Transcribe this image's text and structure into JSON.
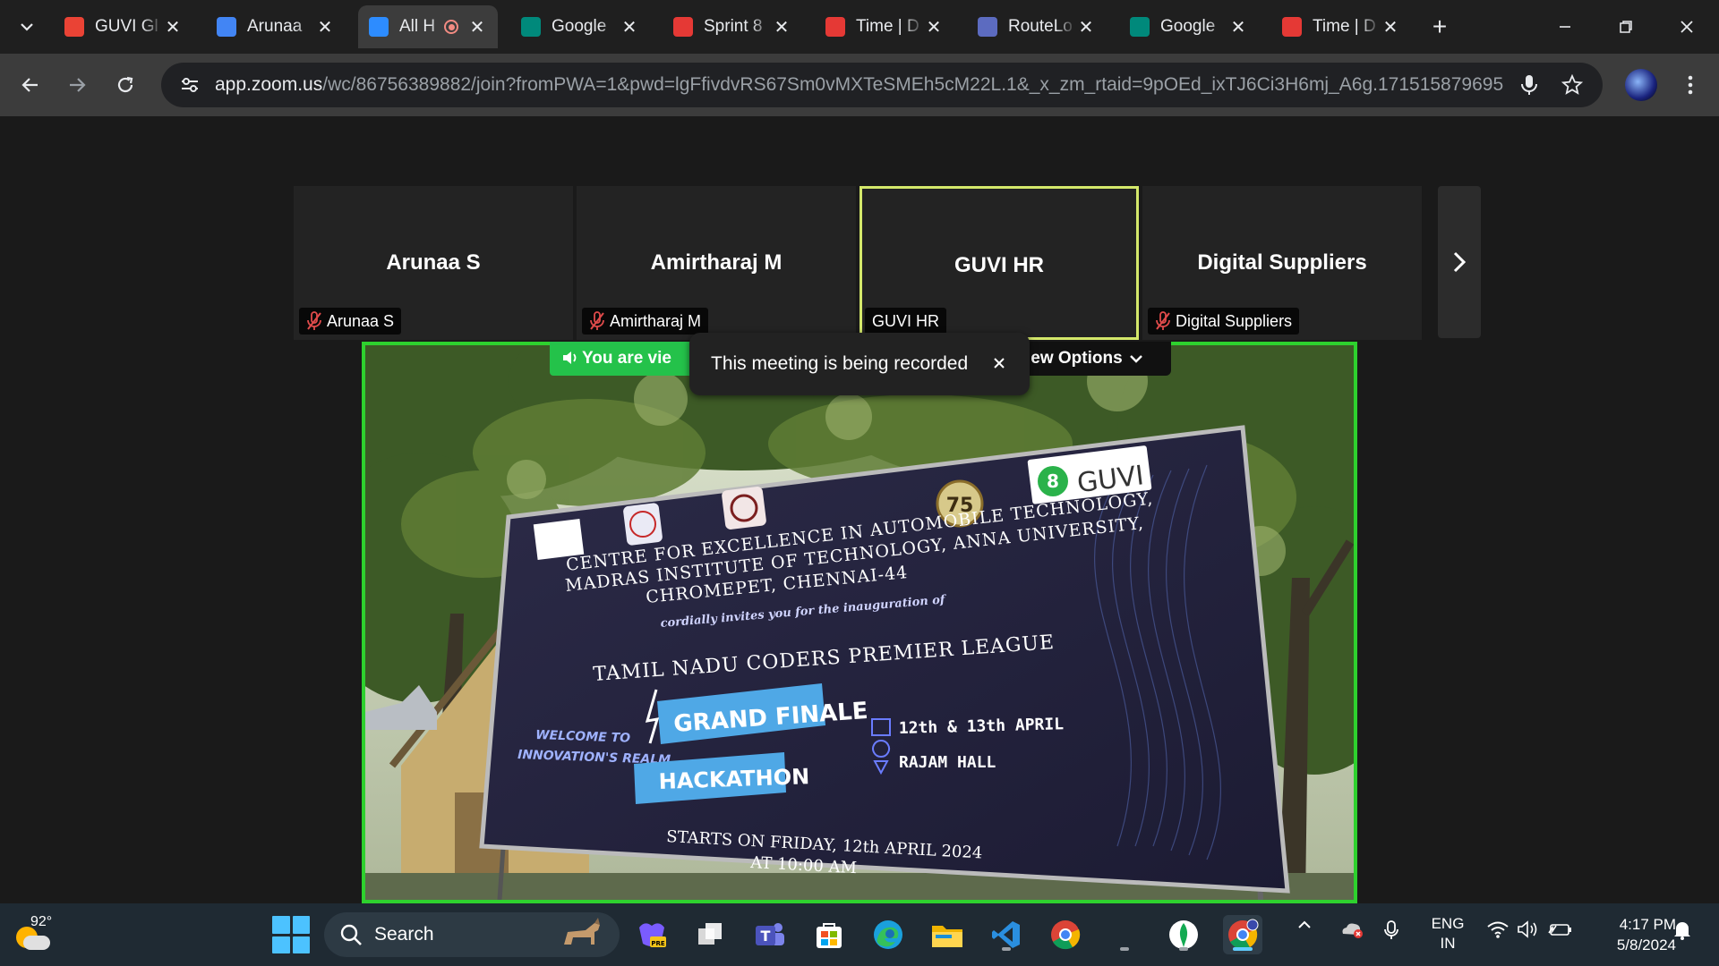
{
  "browser": {
    "tabs": [
      {
        "label": "GUVI Gl",
        "favicon": "gmail-icon",
        "color": "#ea4335",
        "active": false,
        "recording": false
      },
      {
        "label": "Arunaa",
        "favicon": "docs-icon",
        "color": "#4285f4",
        "active": false,
        "recording": false
      },
      {
        "label": "All H",
        "favicon": "zoom-icon",
        "color": "#2d8cff",
        "active": true,
        "recording": true
      },
      {
        "label": "Google",
        "favicon": "meet-icon",
        "color": "#00897b",
        "active": false,
        "recording": false
      },
      {
        "label": "Sprint 8",
        "favicon": "app-icon",
        "color": "#e53935",
        "active": false,
        "recording": false
      },
      {
        "label": "Time | D",
        "favicon": "app-icon",
        "color": "#e53935",
        "active": false,
        "recording": false
      },
      {
        "label": "RouteLo",
        "favicon": "routelo-icon",
        "color": "#5c6bc0",
        "active": false,
        "recording": false
      },
      {
        "label": "Google",
        "favicon": "meet-icon",
        "color": "#00897b",
        "active": false,
        "recording": false
      },
      {
        "label": "Time | D",
        "favicon": "app-icon",
        "color": "#e53935",
        "active": false,
        "recording": false
      }
    ],
    "url_host": "app.zoom.us",
    "url_path": "/wc/86756389882/join?fromPWA=1&pwd=lgFfivdvRS67Sm0vMXTeSMEh5cM22L.1&_x_zm_rtaid=9pOEd_ixTJ6Ci3H6mj_A6g.1715158796952.1..."
  },
  "meeting": {
    "participants": [
      {
        "name": "Arunaa S",
        "tag": "Arunaa S",
        "muted": true,
        "active": false
      },
      {
        "name": "Amirtharaj M",
        "tag": "Amirtharaj M",
        "muted": true,
        "active": false
      },
      {
        "name": "GUVI HR",
        "tag": "GUVI HR",
        "muted": false,
        "active": true
      },
      {
        "name": "Digital Suppliers",
        "tag": "Digital Suppliers",
        "muted": true,
        "active": false
      }
    ],
    "viewing_label": "You are vie",
    "view_options_label": "iew Options",
    "recording_banner": "This meeting is being recorded",
    "active_border_color": "#d4e86b",
    "share_border_color": "#2ed12e"
  },
  "banner": {
    "logo_text": "GUVI",
    "badge_number": "75",
    "line1": "CENTRE FOR EXCELLENCE IN AUTOMOBILE TECHNOLOGY,",
    "line2": "MADRAS INSTITUTE OF TECHNOLOGY, ANNA UNIVERSITY,",
    "line3": "CHROMEPET, CHENNAI-44",
    "invite": "cordially invites you for the inauguration of",
    "event": "TAMIL NADU CODERS PREMIER LEAGUE",
    "welcome1": "WELCOME TO",
    "welcome2": "INNOVATION'S REALM",
    "grand_finale": "GRAND FINALE",
    "hackathon": "HACKATHON",
    "date": "12th & 13th APRIL",
    "venue": "RAJAM HALL",
    "starts1": "STARTS ON FRIDAY, 12th APRIL 2024",
    "starts2": "AT 10:00 AM"
  },
  "taskbar": {
    "temperature": "92°",
    "search_label": "Search",
    "lang_top": "ENG",
    "lang_bottom": "IN",
    "time": "4:17 PM",
    "date": "5/8/2024"
  }
}
